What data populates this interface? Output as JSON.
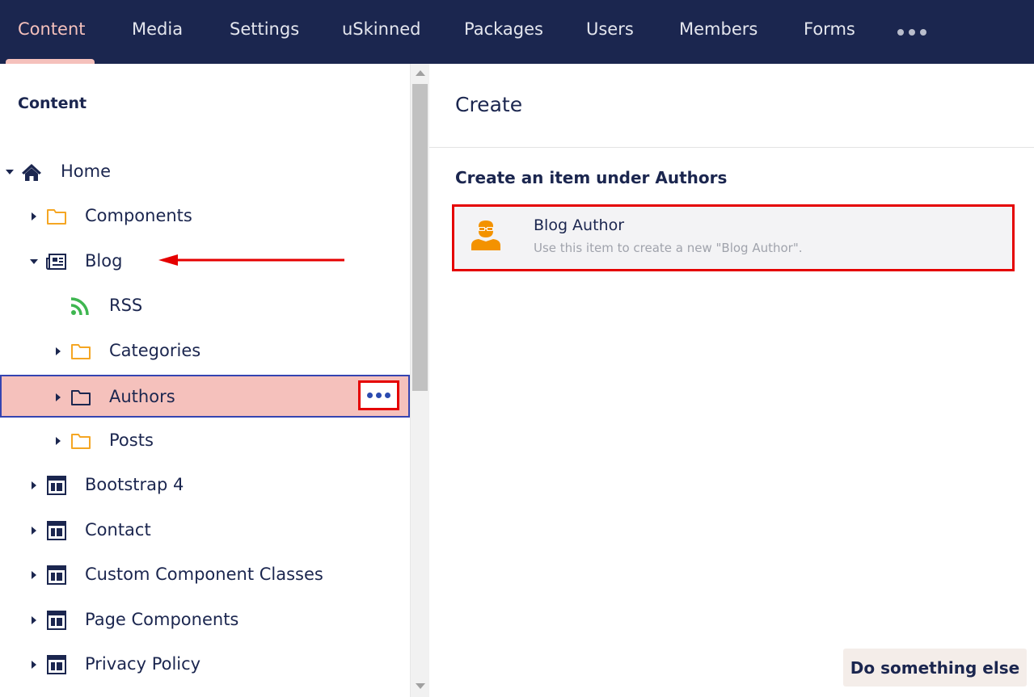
{
  "nav": {
    "items": [
      {
        "label": "Content",
        "active": true
      },
      {
        "label": "Media"
      },
      {
        "label": "Settings"
      },
      {
        "label": "uSkinned"
      },
      {
        "label": "Packages"
      },
      {
        "label": "Users"
      },
      {
        "label": "Members"
      },
      {
        "label": "Forms"
      }
    ],
    "more_icon": "ellipsis-icon"
  },
  "tree": {
    "title": "Content",
    "items": [
      {
        "label": "Home",
        "icon": "home-icon",
        "expanded": true
      },
      {
        "label": "Components",
        "icon": "folder-icon"
      },
      {
        "label": "Blog",
        "icon": "newspaper-icon",
        "expanded": true
      },
      {
        "label": "RSS",
        "icon": "rss-icon"
      },
      {
        "label": "Categories",
        "icon": "folder-icon"
      },
      {
        "label": "Authors",
        "icon": "folder-icon",
        "selected": true
      },
      {
        "label": "Posts",
        "icon": "folder-icon"
      },
      {
        "label": "Bootstrap 4",
        "icon": "page-layout-icon"
      },
      {
        "label": "Contact",
        "icon": "page-layout-icon"
      },
      {
        "label": "Custom Component Classes",
        "icon": "page-layout-icon"
      },
      {
        "label": "Page Components",
        "icon": "page-layout-icon"
      },
      {
        "label": "Privacy Policy",
        "icon": "page-layout-icon"
      }
    ]
  },
  "create": {
    "title": "Create",
    "subtitle": "Create an item under Authors",
    "option": {
      "name": "Blog Author",
      "description": "Use this item to create a new \"Blog Author\".",
      "icon": "user-glasses-icon"
    },
    "secondary_button": "Do something else"
  },
  "colors": {
    "nav_bg": "#1b264f",
    "nav_active": "#f5c1bc",
    "selected_row": "#f5c1bc",
    "highlight_red": "#e50000",
    "folder_orange": "#f5a623",
    "rss_green": "#3eb650",
    "author_orange": "#f39200"
  }
}
